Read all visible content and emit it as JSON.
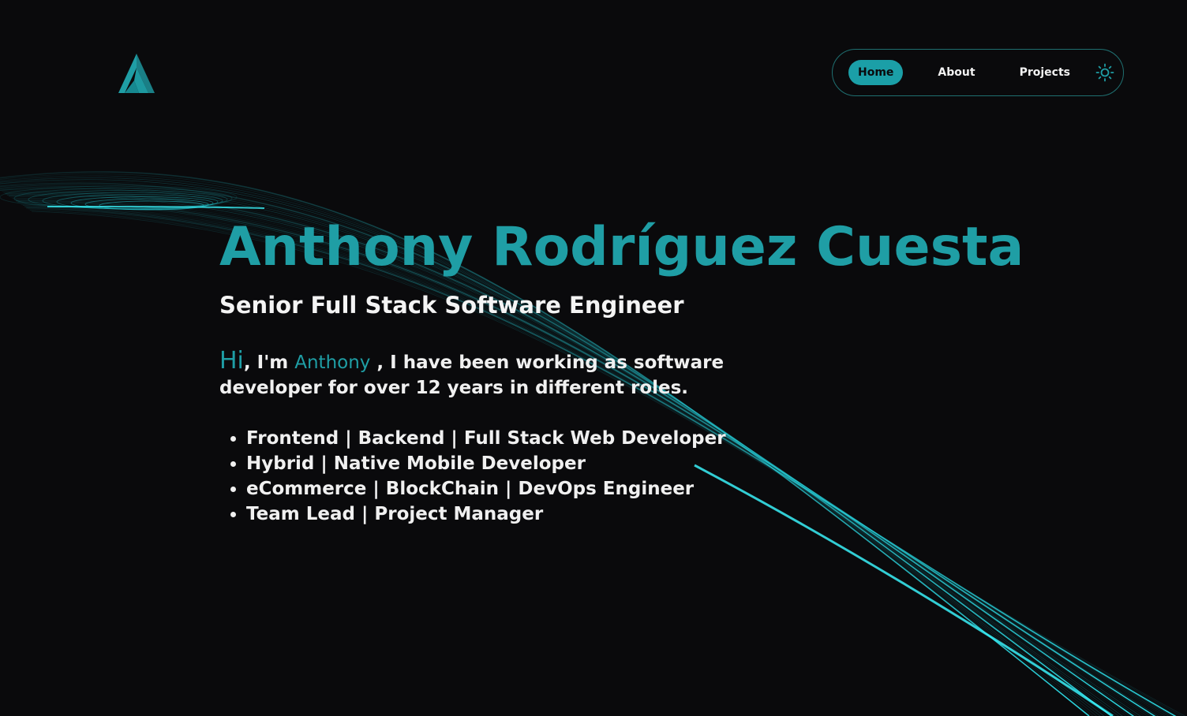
{
  "header": {
    "logo_icon": "a-monogram-logo-icon",
    "nav": {
      "items": [
        {
          "label": "Home",
          "active": true
        },
        {
          "label": "About",
          "active": false
        },
        {
          "label": "Projects",
          "active": false
        }
      ],
      "theme_toggle_icon": "sun-icon"
    }
  },
  "hero": {
    "name": "Anthony Rodríguez Cuesta",
    "role": "Senior Full Stack Software Engineer",
    "intro": {
      "greeting": "Hi",
      "part1": ", I'm ",
      "name": "Anthony",
      "part2": " , I have been working as software developer for over 12 years in different roles."
    },
    "skills": [
      "Frontend | Backend | Full Stack Web Developer",
      "Hybrid | Native Mobile Developer",
      "eCommerce | BlockChain | DevOps Engineer",
      "Team Lead | Project Manager"
    ]
  },
  "colors": {
    "background": "#0a0a0c",
    "accent": "#1f9ea5",
    "nav_active_bg": "#1b9fa7",
    "nav_border": "#1f6f70",
    "wave_glow": "#2ee6f0"
  }
}
